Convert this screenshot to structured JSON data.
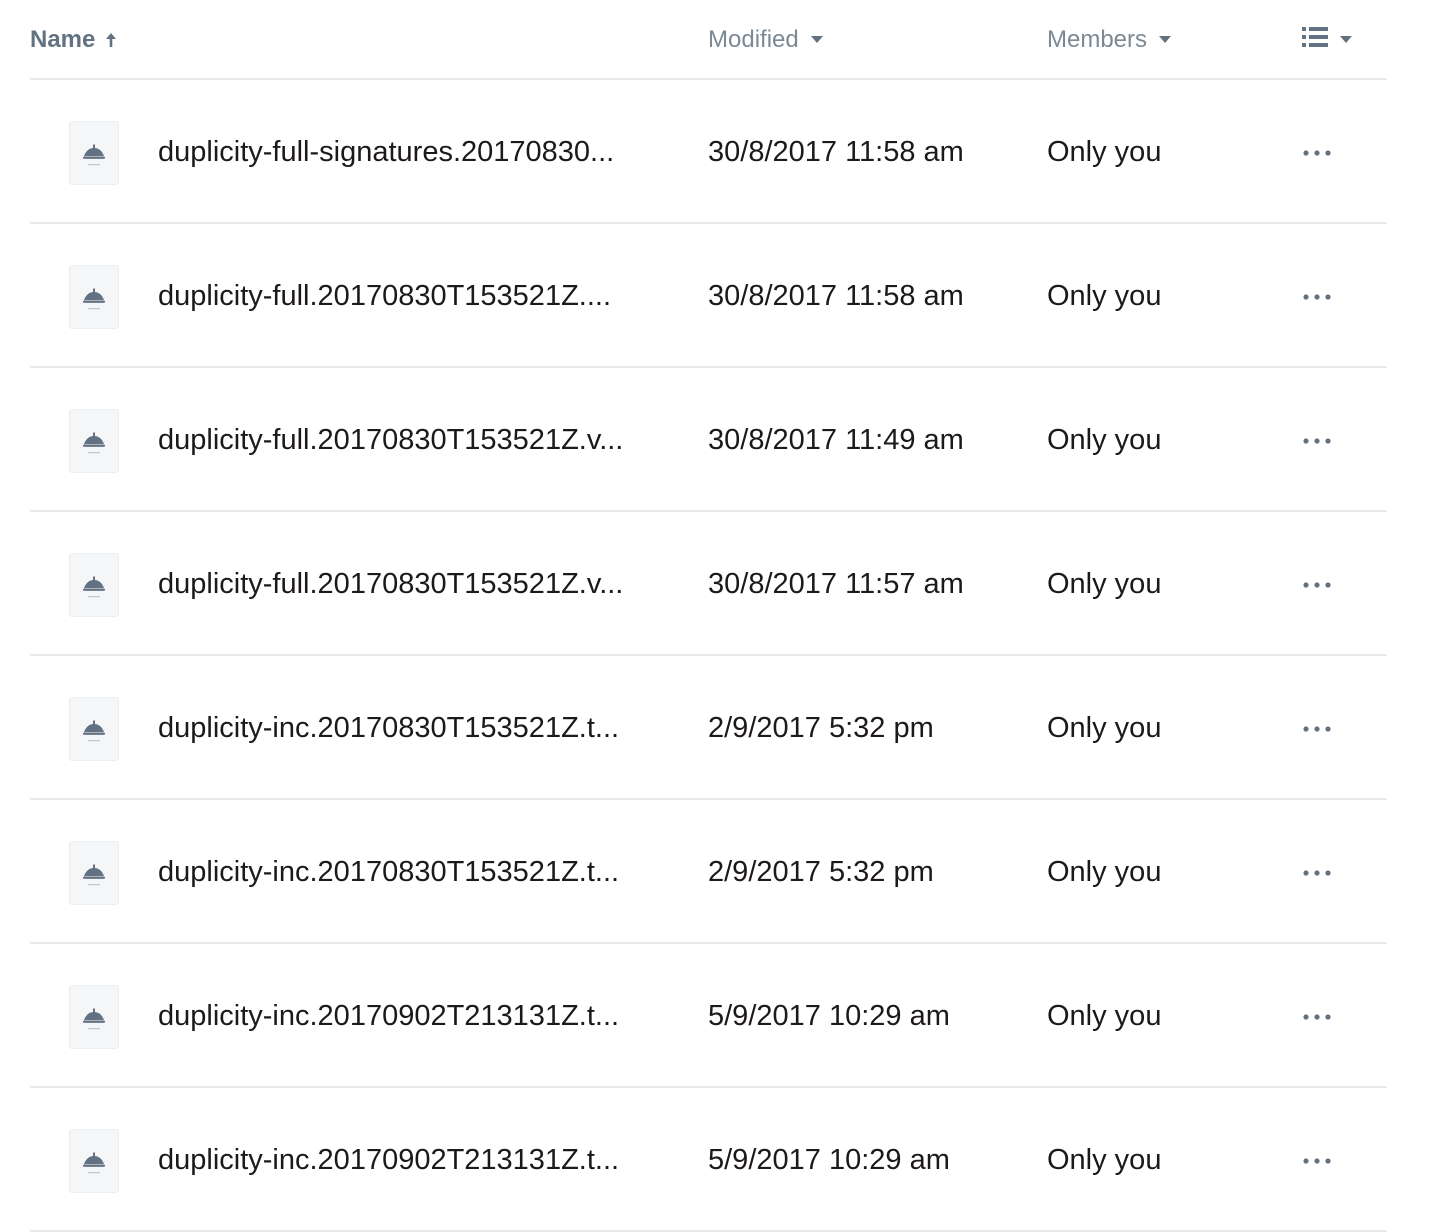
{
  "header": {
    "name_label": "Name",
    "modified_label": "Modified",
    "members_label": "Members",
    "name_sort_icon": "arrow-up-icon",
    "modified_caret_icon": "caret-down-icon",
    "members_caret_icon": "caret-down-icon",
    "view_icon": "list-view-icon"
  },
  "rows": [
    {
      "name": "duplicity-full-signatures.20170830...",
      "modified": "30/8/2017 11:58 am",
      "members": "Only you"
    },
    {
      "name": "duplicity-full.20170830T153521Z....",
      "modified": "30/8/2017 11:58 am",
      "members": "Only you"
    },
    {
      "name": "duplicity-full.20170830T153521Z.v...",
      "modified": "30/8/2017 11:49 am",
      "members": "Only you"
    },
    {
      "name": "duplicity-full.20170830T153521Z.v...",
      "modified": "30/8/2017 11:57 am",
      "members": "Only you"
    },
    {
      "name": "duplicity-inc.20170830T153521Z.t...",
      "modified": "2/9/2017 5:32 pm",
      "members": "Only you"
    },
    {
      "name": "duplicity-inc.20170830T153521Z.t...",
      "modified": "2/9/2017 5:32 pm",
      "members": "Only you"
    },
    {
      "name": "duplicity-inc.20170902T213131Z.t...",
      "modified": "5/9/2017 10:29 am",
      "members": "Only you"
    },
    {
      "name": "duplicity-inc.20170902T213131Z.t...",
      "modified": "5/9/2017 10:29 am",
      "members": "Only you"
    }
  ],
  "row_icon": "file-icon",
  "row_action_icon": "more-options-icon",
  "colors": {
    "header_text": "#7b8994",
    "row_text": "#1e1919",
    "divider": "#e6e8eb",
    "icon_gray": "#637282"
  }
}
